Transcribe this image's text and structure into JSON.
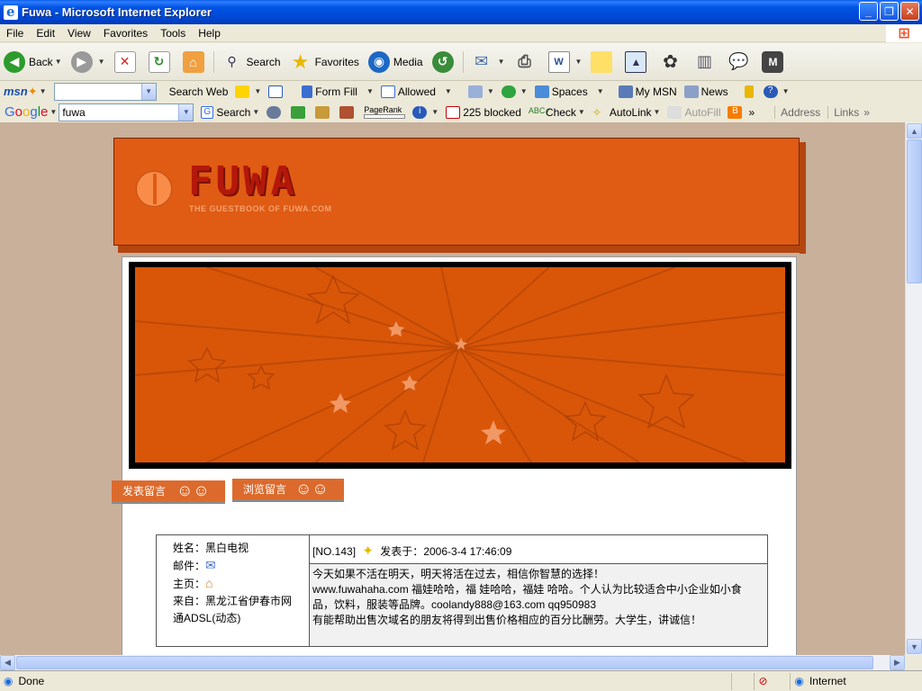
{
  "window": {
    "title": "Fuwa - Microsoft Internet Explorer"
  },
  "menu": [
    "File",
    "Edit",
    "View",
    "Favorites",
    "Tools",
    "Help"
  ],
  "toolbar": {
    "back": "Back",
    "search": "Search",
    "favorites": "Favorites",
    "media": "Media"
  },
  "msnbar": {
    "search_web": "Search Web",
    "form_fill": "Form Fill",
    "allowed": "Allowed",
    "spaces": "Spaces",
    "my_msn": "My MSN",
    "news": "News"
  },
  "googlebar": {
    "query": "fuwa",
    "search": "Search",
    "pagerank": "PageRank",
    "blocked": "225 blocked",
    "check": "Check",
    "autolink": "AutoLink",
    "autofill": "AutoFill",
    "address": "Address",
    "links": "Links"
  },
  "site": {
    "logo": "FUWA",
    "tagline": "THE GUESTBOOK OF FUWA.COM",
    "tab_post": "发表留言",
    "tab_browse": "浏览留言"
  },
  "entry": {
    "name_label": "姓名：",
    "name": "黑白电视",
    "email_label": "邮件：",
    "home_label": "主页：",
    "from_label": "来自：",
    "from": "黑龙江省伊春市网通ADSL(动态)",
    "number": "[NO.143]",
    "posted_label": "发表于：",
    "posted_at": "2006-3-4 17:46:09",
    "lines": [
      "今天如果不活在明天，明天将活在过去，相信你智慧的选择！",
      "www.fuwahaha.com 福娃哈哈，福 娃哈哈，福娃 哈哈。个人认为比较适合中小企业如小食",
      "品，饮料，服装等品牌。coolandy888@163.com qq950983",
      "有能帮助出售次域名的朋友将得到出售价格相应的百分比酬劳。大学生，讲诚信！"
    ]
  },
  "status": {
    "text": "Done",
    "zone": "Internet"
  }
}
